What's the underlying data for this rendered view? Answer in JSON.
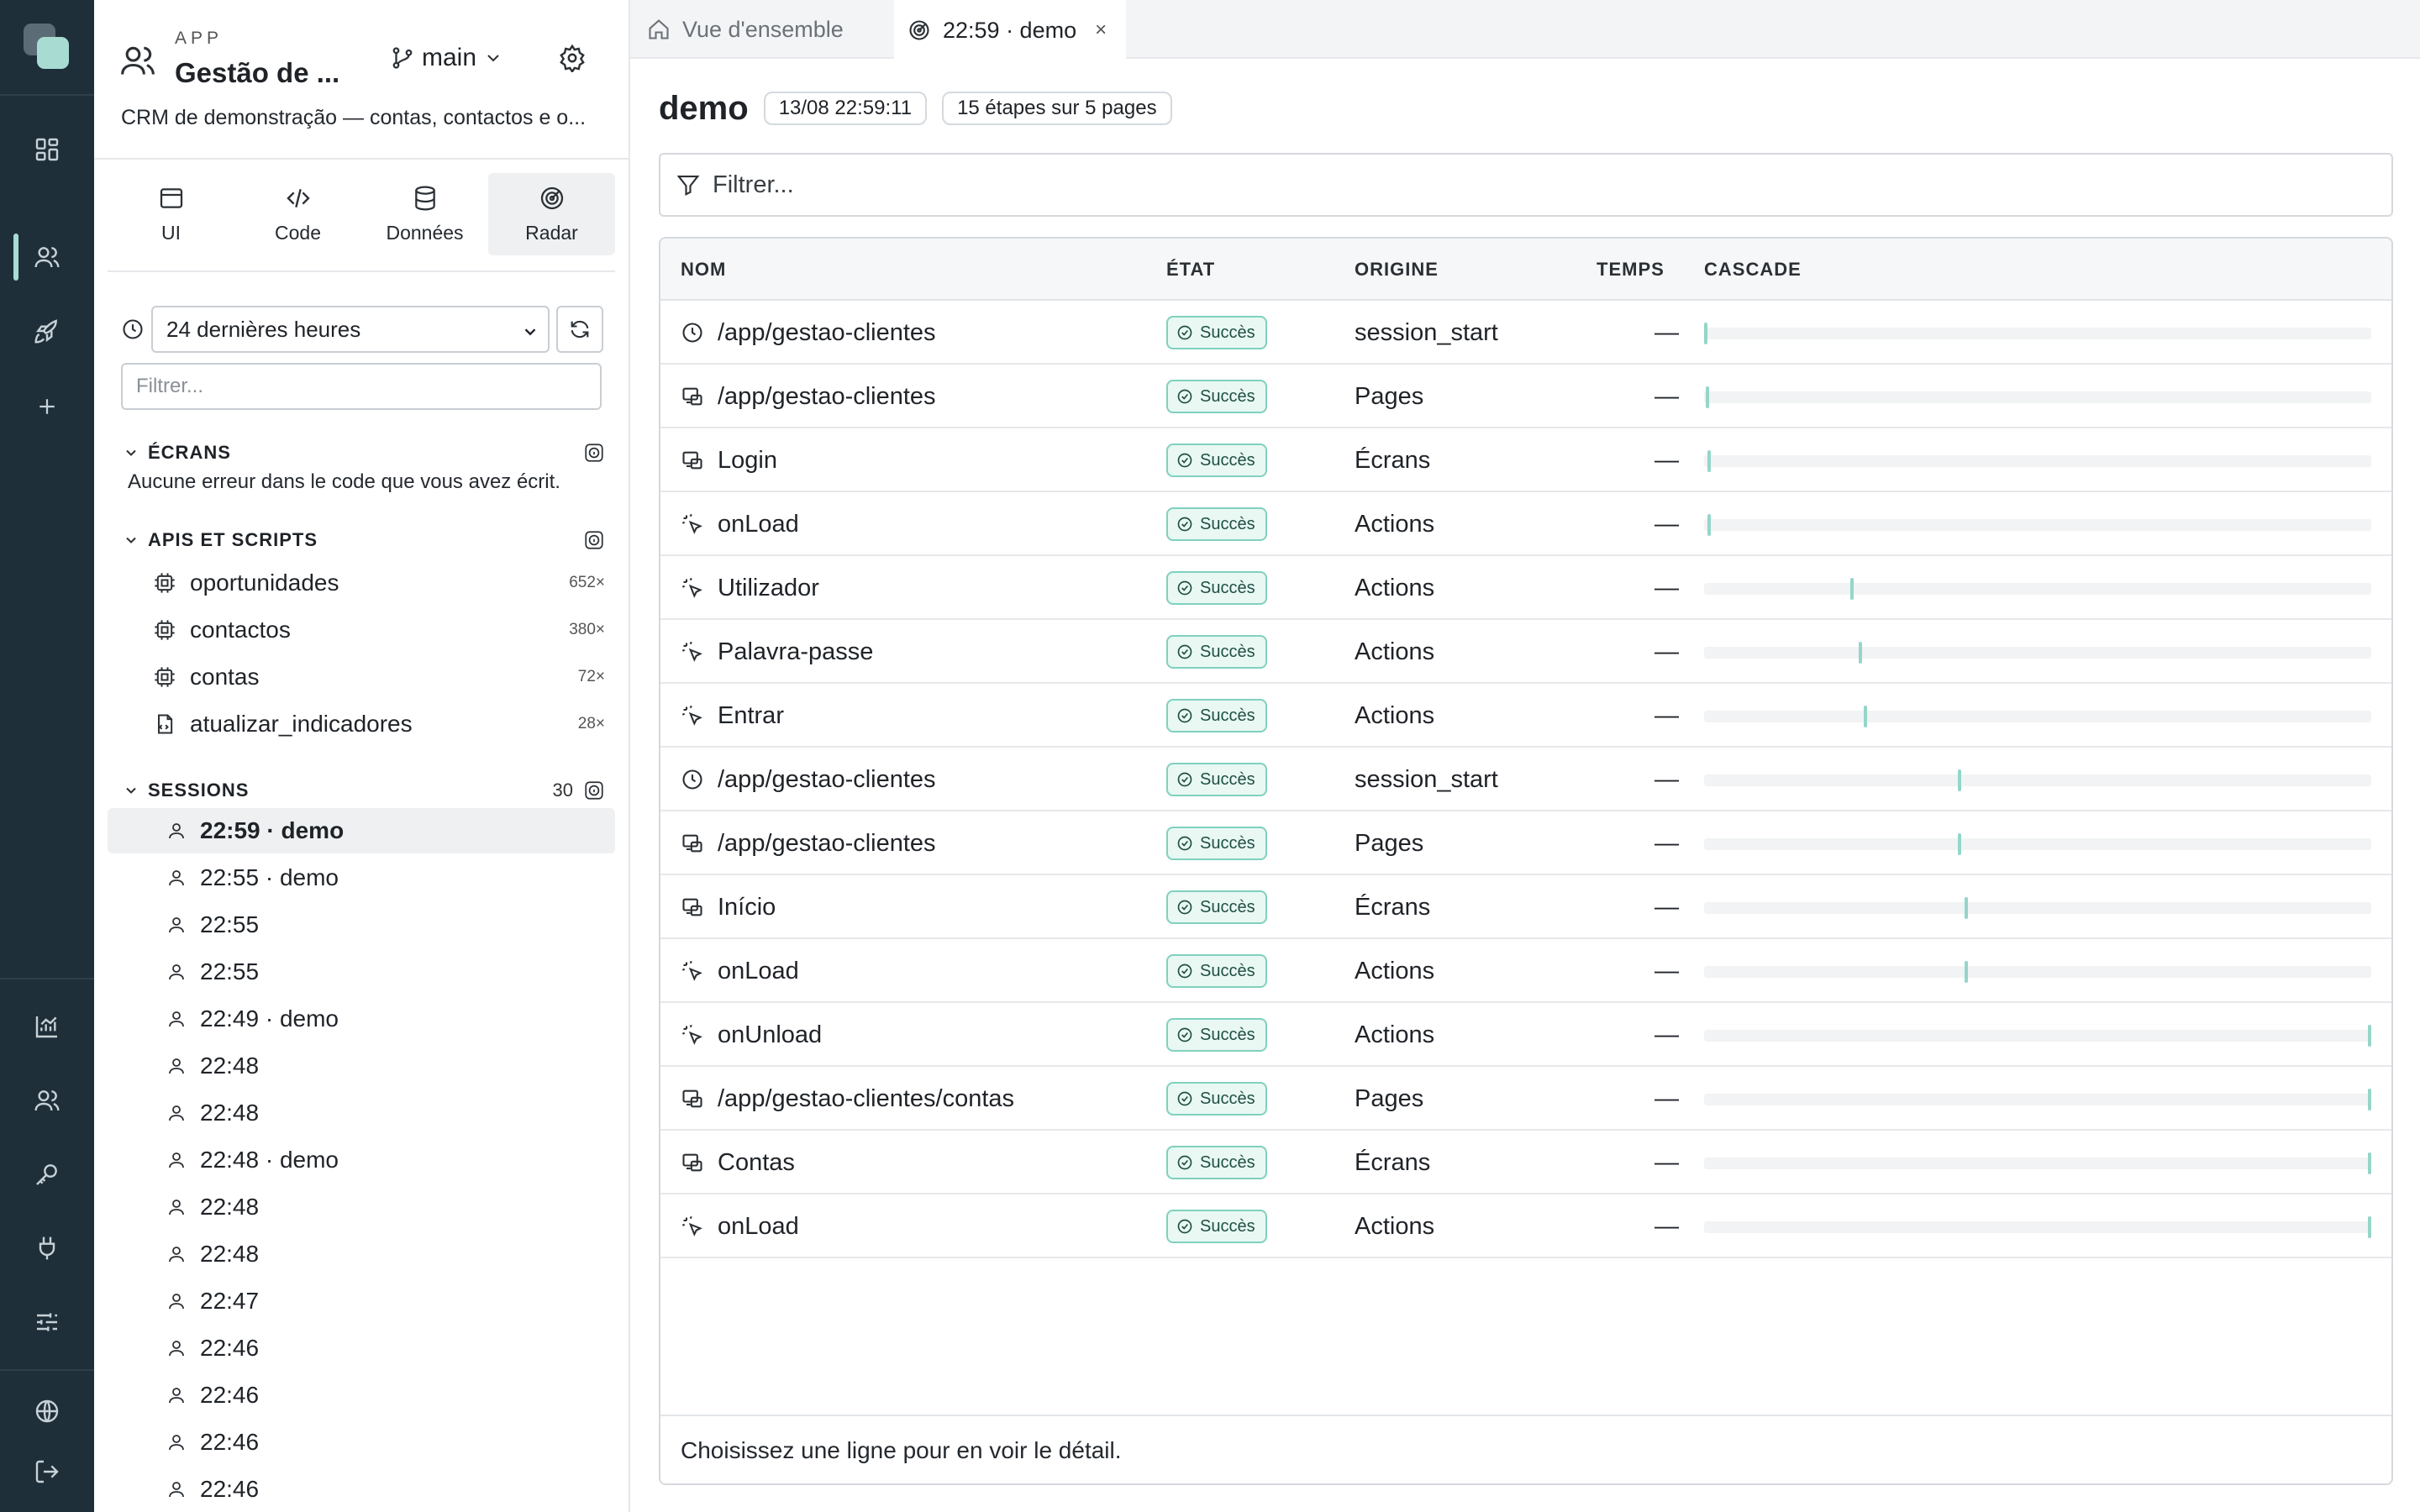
{
  "app": {
    "kicker": "APP",
    "title": "Gestão de ...",
    "branch": "main",
    "description": "CRM de demonstração — contas, contactos e o..."
  },
  "modes": [
    {
      "label": "UI",
      "icon": "window-icon"
    },
    {
      "label": "Code",
      "icon": "code-icon"
    },
    {
      "label": "Données",
      "icon": "database-icon"
    },
    {
      "label": "Radar",
      "icon": "radar-icon",
      "active": true
    }
  ],
  "filters": {
    "range": "24 dernières heures",
    "filter_placeholder": "Filtrer..."
  },
  "sections": {
    "ecrans": {
      "title": "ÉCRANS",
      "empty": "Aucune erreur dans le code que vous avez écrit."
    },
    "apis": {
      "title": "APIS ET SCRIPTS"
    },
    "sessions": {
      "title": "SESSIONS",
      "count": "30"
    }
  },
  "apis": [
    {
      "name": "oportunidades",
      "count": "652×",
      "icon": "cpu-icon"
    },
    {
      "name": "contactos",
      "count": "380×",
      "icon": "cpu-icon"
    },
    {
      "name": "contas",
      "count": "72×",
      "icon": "cpu-icon"
    },
    {
      "name": "atualizar_indicadores",
      "count": "28×",
      "icon": "script-icon"
    }
  ],
  "sessions": [
    {
      "label": "22:59 · demo",
      "active": true
    },
    {
      "label": "22:55 · demo"
    },
    {
      "label": "22:55"
    },
    {
      "label": "22:55"
    },
    {
      "label": "22:49 · demo"
    },
    {
      "label": "22:48"
    },
    {
      "label": "22:48"
    },
    {
      "label": "22:48 · demo"
    },
    {
      "label": "22:48"
    },
    {
      "label": "22:48"
    },
    {
      "label": "22:47"
    },
    {
      "label": "22:46"
    },
    {
      "label": "22:46"
    },
    {
      "label": "22:46"
    },
    {
      "label": "22:46"
    }
  ],
  "tabs": [
    {
      "label": "Vue d'ensemble",
      "icon": "home-icon"
    },
    {
      "label": "22:59 · demo",
      "icon": "radar-icon",
      "active": true,
      "close": "×"
    }
  ],
  "page": {
    "title": "demo",
    "timestamp": "13/08 22:59:11",
    "steps": "15 étapes sur 5 pages",
    "filter_placeholder": "Filtrer...",
    "detail_hint": "Choisissez une ligne pour en voir le détail."
  },
  "columns": {
    "name": "NOM",
    "state": "ÉTAT",
    "origin": "ORIGINE",
    "time": "TEMPS",
    "cascade": "CASCADE"
  },
  "rows": [
    {
      "icon": "clock-icon",
      "name": "/app/gestao-clientes",
      "state": "Succès",
      "origin": "session_start",
      "time": "—",
      "offset": 0.0
    },
    {
      "icon": "pages-icon",
      "name": "/app/gestao-clientes",
      "state": "Succès",
      "origin": "Pages",
      "time": "—",
      "offset": 0.003
    },
    {
      "icon": "pages-icon",
      "name": "Login",
      "state": "Succès",
      "origin": "Écrans",
      "time": "—",
      "offset": 0.005
    },
    {
      "icon": "pointer-icon",
      "name": "onLoad",
      "state": "Succès",
      "origin": "Actions",
      "time": "—",
      "offset": 0.005
    },
    {
      "icon": "pointer-icon",
      "name": "Utilizador",
      "state": "Succès",
      "origin": "Actions",
      "time": "—",
      "offset": 0.22
    },
    {
      "icon": "pointer-icon",
      "name": "Palavra-passe",
      "state": "Succès",
      "origin": "Actions",
      "time": "—",
      "offset": 0.233
    },
    {
      "icon": "pointer-icon",
      "name": "Entrar",
      "state": "Succès",
      "origin": "Actions",
      "time": "—",
      "offset": 0.24
    },
    {
      "icon": "clock-icon",
      "name": "/app/gestao-clientes",
      "state": "Succès",
      "origin": "session_start",
      "time": "—",
      "offset": 0.382
    },
    {
      "icon": "pages-icon",
      "name": "/app/gestao-clientes",
      "state": "Succès",
      "origin": "Pages",
      "time": "—",
      "offset": 0.382
    },
    {
      "icon": "pages-icon",
      "name": "Início",
      "state": "Succès",
      "origin": "Écrans",
      "time": "—",
      "offset": 0.392
    },
    {
      "icon": "pointer-icon",
      "name": "onLoad",
      "state": "Succès",
      "origin": "Actions",
      "time": "—",
      "offset": 0.392
    },
    {
      "icon": "pointer-icon",
      "name": "onUnload",
      "state": "Succès",
      "origin": "Actions",
      "time": "—",
      "offset": 1.0
    },
    {
      "icon": "pages-icon",
      "name": "/app/gestao-clientes/contas",
      "state": "Succès",
      "origin": "Pages",
      "time": "—",
      "offset": 1.0
    },
    {
      "icon": "pages-icon",
      "name": "Contas",
      "state": "Succès",
      "origin": "Écrans",
      "time": "—",
      "offset": 1.0
    },
    {
      "icon": "pointer-icon",
      "name": "onLoad",
      "state": "Succès",
      "origin": "Actions",
      "time": "—",
      "offset": 1.0
    }
  ],
  "colors": {
    "rail": "#1e2f3a",
    "accent": "#a8dcd3",
    "success_border": "#7fd1bd",
    "success_bg": "#e9f8f3"
  }
}
